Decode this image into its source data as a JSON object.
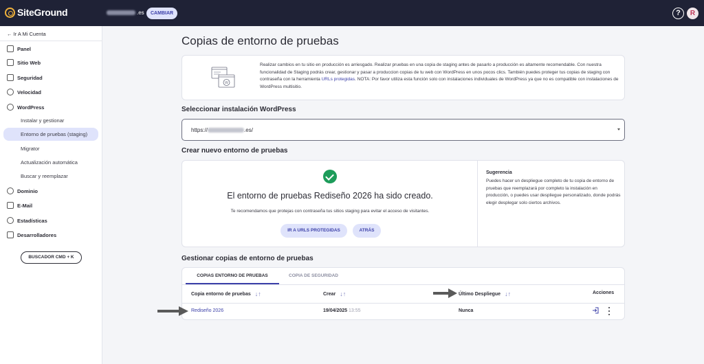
{
  "topbar": {
    "logo_text": "SiteGround",
    "domain_suffix": ".es",
    "cambiar_label": "CAMBIAR",
    "help_glyph": "?",
    "avatar_initial": "R"
  },
  "sidebar": {
    "back_label": "← Ir A Mi Cuenta",
    "items": [
      {
        "label": "Panel",
        "icon": "grid-icon"
      },
      {
        "label": "Sitio Web",
        "icon": "browser-icon"
      },
      {
        "label": "Seguridad",
        "icon": "lock-icon"
      },
      {
        "label": "Velocidad",
        "icon": "speed-icon"
      },
      {
        "label": "WordPress",
        "icon": "wordpress-icon"
      }
    ],
    "sub_items": [
      {
        "label": "Instalar y gestionar"
      },
      {
        "label": "Entorno de pruebas (staging)"
      },
      {
        "label": "Migrator"
      },
      {
        "label": "Actualización automática"
      },
      {
        "label": "Buscar y reemplazar"
      }
    ],
    "items_bottom": [
      {
        "label": "Dominio",
        "icon": "globe-icon"
      },
      {
        "label": "E-Mail",
        "icon": "mail-icon"
      },
      {
        "label": "Estadísticas",
        "icon": "stats-icon"
      },
      {
        "label": "Desarrolladores",
        "icon": "code-icon"
      }
    ],
    "search_button": "BUSCADOR CMD + K"
  },
  "main": {
    "title": "Copias de entorno de pruebas",
    "info_text_1": "Realizar cambios en tu sitio en producción es arriesgado. Realizar pruebas en una copia de staging antes de pasarlo a producción es altamente recomendable. Con nuestra funcionalidad de Staging podrás crear, gestionar y pasar a produccion copias de tu web con WordPress en unos pocos clics. También puedes proteger tus copias de staging con contraseña con la herramienta ",
    "info_link": "URLs protegidas",
    "info_text_2": ". NOTA: Por favor utiliza esta función solo con instalaciones individuales de WordPress ya que no es compatible con instalaciones de WordPress multisitio.",
    "select_section_title": "Seleccionar instalación WordPress",
    "select_prefix": "https://",
    "select_suffix": ".es/",
    "create_section_title": "Crear nuevo entorno de pruebas",
    "success_title": "El entorno de pruebas Rediseño 2026 ha sido creado.",
    "success_sub": "Te recomendamos que protejas con contraseña tus sitios staging para evitar el acceso de visitantes.",
    "btn_protected": "IR A URLS PROTEGIDAS",
    "btn_back": "ATRÁS",
    "tip_title": "Sugerencia",
    "tip_text": "Puedes hacer un despliegue completo de tu copia de entorno de pruebas que reemplazará por completo la instalación en producción, o puedes usar despliegue personalizado, donde podrás elegir desplegar solo ciertos archivos.",
    "manage_section_title": "Gestionar copias de entorno de pruebas",
    "tabs": [
      {
        "label": "COPIAS ENTORNO DE PRUEBAS"
      },
      {
        "label": "COPIA DE SEGURIDAD"
      }
    ],
    "table": {
      "headers": [
        "Copia entorno de pruebas",
        "Crear",
        "Último Despliegue",
        "Acciones"
      ],
      "rows": [
        {
          "name": "Rediseño 2026",
          "date": "19/04/2025",
          "time": "13:55",
          "last_deploy": "Nunca"
        }
      ]
    }
  },
  "colors": {
    "topbar": "#1f2236",
    "accent": "#3b3fa8",
    "accent_soft": "#dfe3fb",
    "success": "#1d9c5a"
  }
}
